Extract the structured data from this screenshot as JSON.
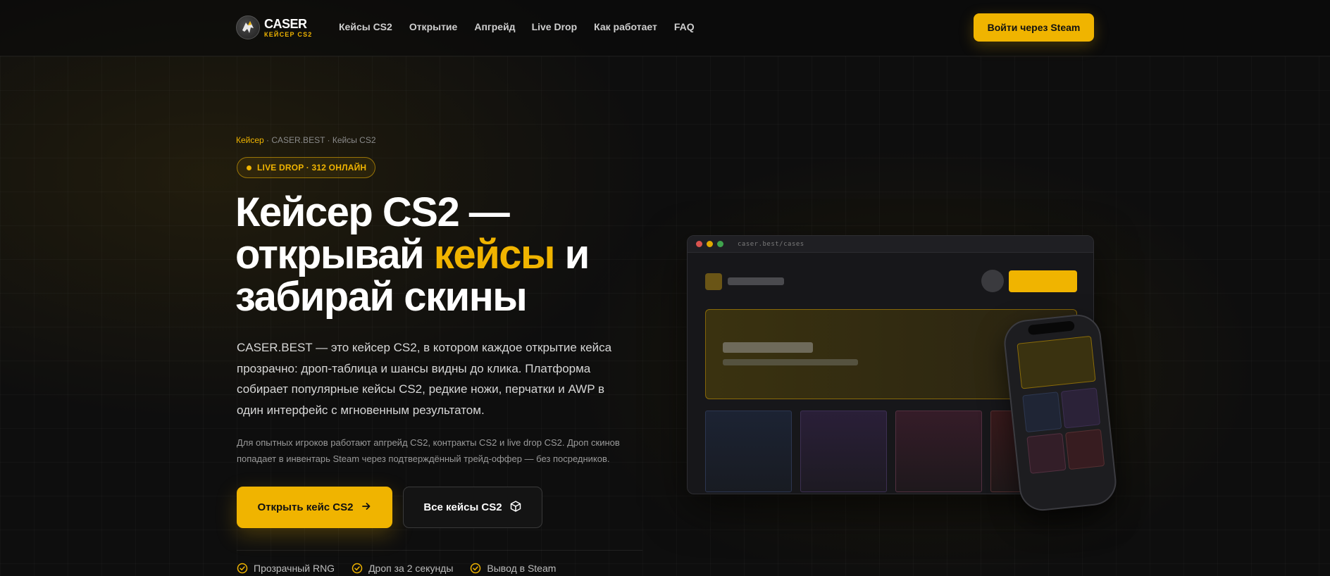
{
  "header": {
    "logo_name": "CASER",
    "logo_sub": "КЕЙСЕР CS2",
    "nav": [
      "Кейсы CS2",
      "Открытие",
      "Апгрейд",
      "Live Drop",
      "Как работает",
      "FAQ"
    ],
    "login_label": "Войти через Steam"
  },
  "hero": {
    "breadcrumb_active": "Кейсер",
    "breadcrumb_rest": " · CASER.BEST · Кейсы CS2",
    "badge": "LIVE DROP · 312 ОНЛАЙН",
    "title_line1": "Кейсер CS2 —",
    "title_line2_a": "открывай ",
    "title_line2_hl": "кейсы",
    "title_line2_b": " и",
    "title_line3": "забирай скины",
    "description": "CASER.BEST — это кейсер CS2, в котором каждое открытие кейса прозрачно: дроп-таблица и шансы видны до клика. Платформа собирает популярные кейсы CS2, редкие ножи, перчатки и AWP в один интерфейс с мгновенным результатом.",
    "note": "Для опытных игроков работают апгрейд CS2, контракты CS2 и live drop CS2. Дроп скинов попадает в инвентарь Steam через подтверждённый трейд-оффер — без посредников.",
    "primary_button": "Открыть кейс CS2",
    "secondary_button": "Все кейсы CS2",
    "features": [
      "Прозрачный RNG",
      "Дроп за 2 секунды",
      "Вывод в Steam"
    ]
  },
  "mockup": {
    "url": "caser.best/cases"
  },
  "colors": {
    "accent": "#f0b400",
    "background": "#0e0e0e"
  }
}
